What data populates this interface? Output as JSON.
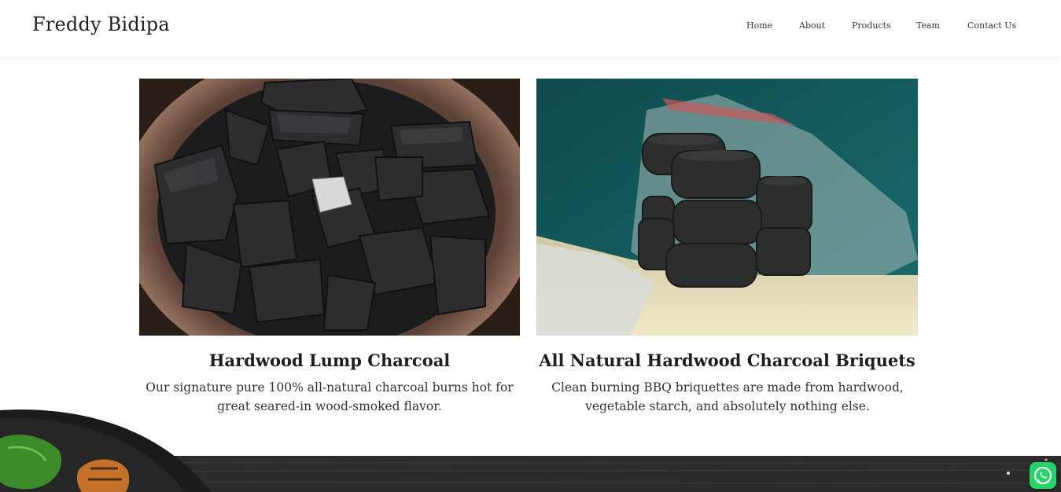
{
  "header": {
    "brand": "Freddy Bidipa",
    "nav": [
      "Home",
      "About",
      "Products",
      "Team",
      "Contact Us"
    ]
  },
  "products": [
    {
      "title": "Hardwood Lump Charcoal",
      "description": "Our signature pure 100% all-natural charcoal burns hot for great seared-in wood-smoked flavor.",
      "image_icon": "lump-charcoal-photo"
    },
    {
      "title": "All Natural Hardwood Charcoal Briquets",
      "description": "Clean burning BBQ briquettes are made from hardwood, vegetable starch, and absolutely nothing else.",
      "image_icon": "charcoal-briquettes-photo"
    }
  ],
  "floating": {
    "whatsapp_icon": "whatsapp-icon",
    "whatsapp_color": "#25d366"
  }
}
